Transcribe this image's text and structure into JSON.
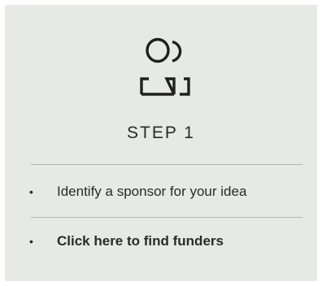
{
  "card": {
    "step_title": "STEP 1",
    "icon": "people-icon",
    "items": [
      {
        "bullet": "•",
        "text": "Identify a sponsor for your idea"
      },
      {
        "bullet": "•",
        "text": "Click here to find funders"
      }
    ]
  },
  "colors": {
    "card_background": "#e7e9e6",
    "text": "#2a2a2a",
    "divider": "#b3b5b2"
  }
}
